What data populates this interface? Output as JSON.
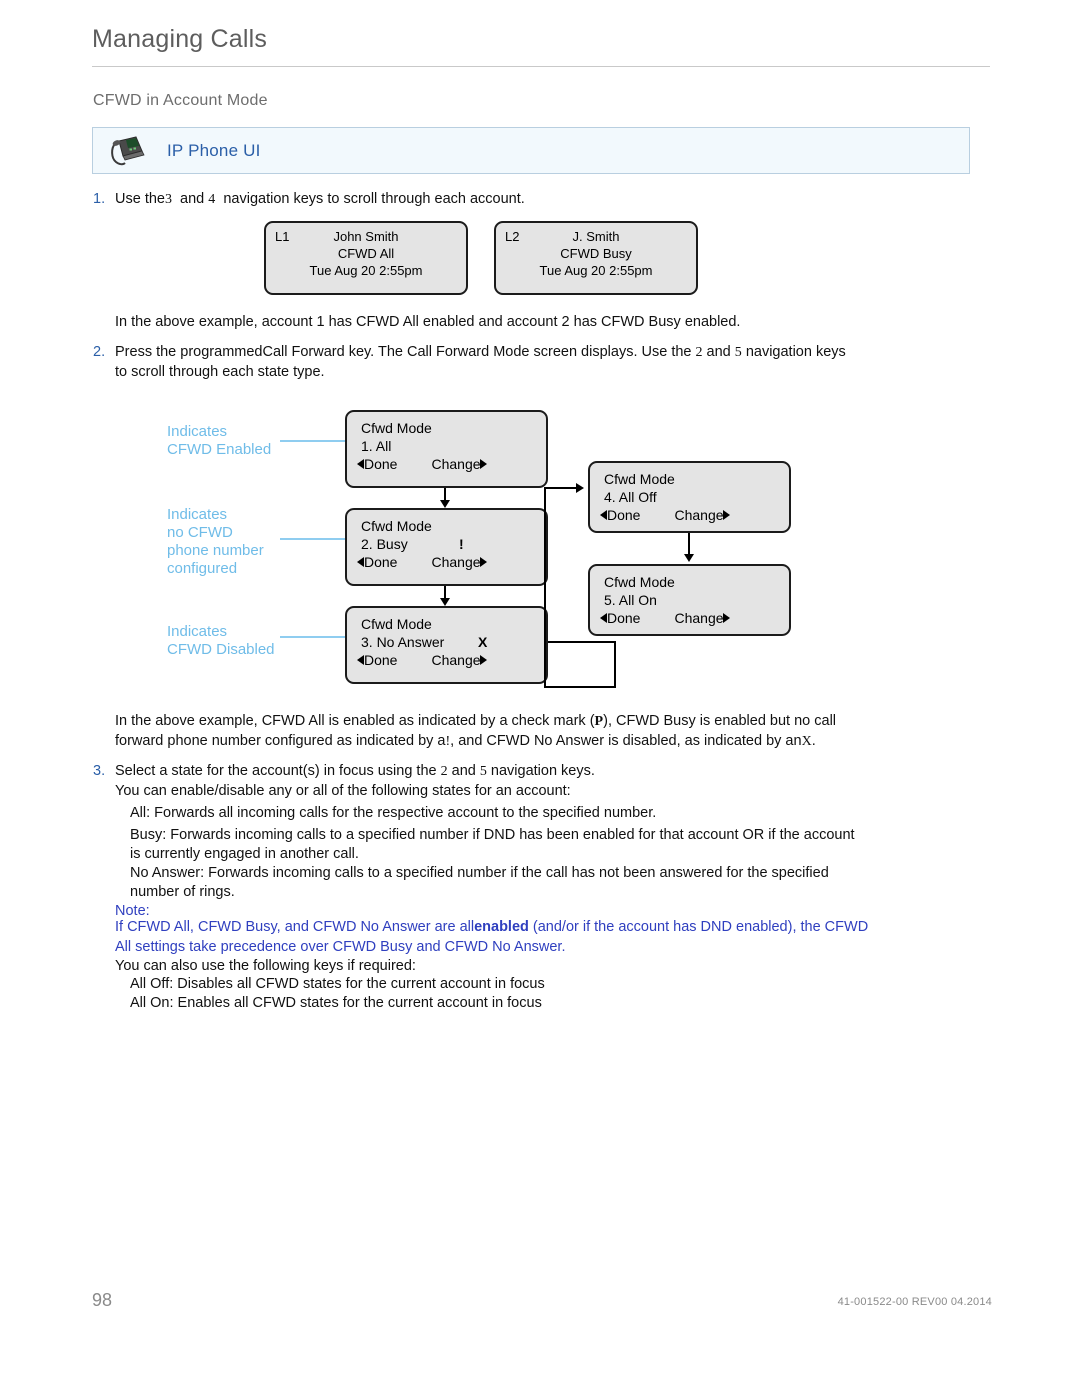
{
  "header": {
    "title": "Managing Calls",
    "subheading": "CFWD in Account Mode"
  },
  "banner": {
    "icon": "desk-phone-icon",
    "label": "IP Phone UI"
  },
  "steps": {
    "step1": {
      "num": "1.",
      "text_a": "Use the",
      "key_a": "3",
      "text_b": "and",
      "key_b": "4",
      "text_c": "navigation keys to scroll through each account."
    },
    "example1": "In the above example, account 1 has CFWD All enabled and account 2 has CFWD Busy enabled.",
    "step2": {
      "num": "2.",
      "text_a": "Press the programmed",
      "text_b": "Call Forward key. The Call Forward Mode screen displays. Use the",
      "key_a": "2",
      "text_c": "and",
      "key_b": "5",
      "text_d": "navigation keys",
      "line2": "to scroll through each state type."
    },
    "example2_line1_a": "In the above example, CFWD All is enabled as indicated by a check mark (",
    "example2_line1_key": "P",
    "example2_line1_b": "), CFWD Busy is enabled but no call",
    "example2_line2_a": "forward phone number configured as indicated by a",
    "example2_line2_key": "!",
    "example2_line2_b": ", and CFWD No Answer is disabled, as indicated by an",
    "example2_line2_key2": "X",
    "example2_line2_c": ".",
    "step3": {
      "num": "3.",
      "text_a": "Select a state for the account(s) in focus using the",
      "key_a": "2",
      "text_b": "and",
      "key_b": "5",
      "text_c": "navigation keys."
    },
    "step3_intro": "You can enable/disable any or all of the following states for an account:",
    "state_all": "All: Forwards all incoming calls for the respective account to the specified number.",
    "state_busy_l1": "Busy: Forwards incoming calls to a specified number if DND has been enabled for that account OR if the account",
    "state_busy_l2": "is currently engaged in another call.",
    "state_noanswer_l1": "No Answer: Forwards incoming calls to a specified number if the call has not been answered for the specified",
    "state_noanswer_l2": "number of rings."
  },
  "note": {
    "label": "Note:",
    "line1_a": "If CFWD All, CFWD Busy, and CFWD No Answer are all",
    "line1_key": "enabled",
    "line1_b": " (and/or if the account",
    "line1_c": " has DND enabled), the CFWD",
    "line2": "All settings take precedence over CFWD Busy and CFWD No Answer.",
    "followup": "You can also use the following keys if required:",
    "all_off": "All Off: Disables all CFWD states for the current account in focus",
    "all_on": "All On: Enables all CFWD states for the current account in focus"
  },
  "lcd_screens": [
    {
      "line_tag": "L1",
      "name": "John Smith",
      "status": "CFWD All",
      "datetime": "Tue Aug 20 2:55pm"
    },
    {
      "line_tag": "L2",
      "name": "J. Smith",
      "status": "CFWD Busy",
      "datetime": "Tue Aug 20 2:55pm"
    }
  ],
  "mode_boxes": [
    {
      "title": "Cfwd Mode",
      "item": "1. All",
      "indicator": "",
      "softkey_left": "Done",
      "softkey_right": "Change"
    },
    {
      "title": "Cfwd Mode",
      "item": "2. Busy",
      "indicator": "!",
      "softkey_left": "Done",
      "softkey_right": "Change"
    },
    {
      "title": "Cfwd Mode",
      "item": "3. No Answer",
      "indicator": "X",
      "softkey_left": "Done",
      "softkey_right": "Change"
    },
    {
      "title": "Cfwd Mode",
      "item": "4. All Off",
      "indicator": "",
      "softkey_left": "Done",
      "softkey_right": "Change"
    },
    {
      "title": "Cfwd Mode",
      "item": "5. All On",
      "indicator": "",
      "softkey_left": "Done",
      "softkey_right": "Change"
    }
  ],
  "callouts": [
    {
      "text": "Indicates\nCFWD Enabled"
    },
    {
      "text": "Indicates\nno CFWD\nphone number\nconfigured"
    },
    {
      "text": "Indicates\nCFWD Disabled"
    }
  ],
  "footer": {
    "page_number": "98",
    "doc_id": "41-001522-00 REV00  04.2014"
  },
  "colors": {
    "accent_blue": "#2b5fa8",
    "callout_blue": "#6fbce8",
    "note_blue": "#2f3fbf",
    "header_gray": "#5d5d5d",
    "lcd_gray": "#e4e4e4"
  }
}
